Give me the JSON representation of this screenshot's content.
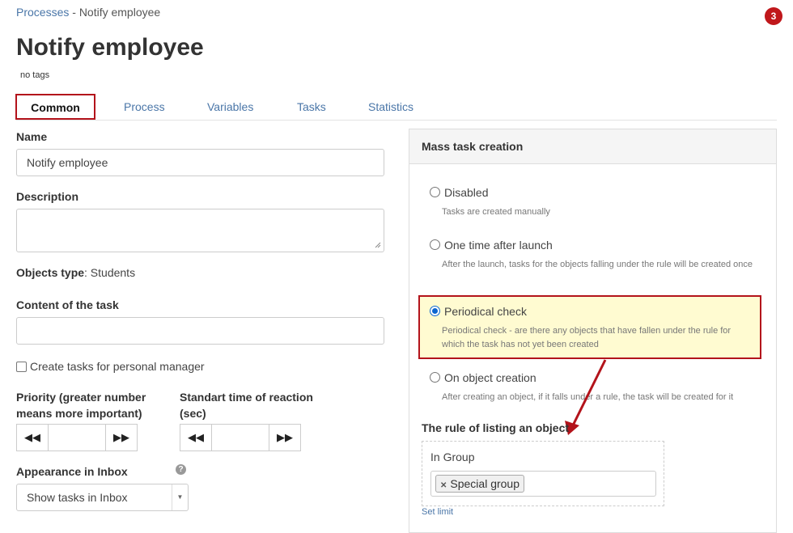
{
  "breadcrumb": {
    "parent": "Processes",
    "separator": "-",
    "current": "Notify employee"
  },
  "notifications_badge": "3",
  "page": {
    "title": "Notify employee",
    "tags": "no tags"
  },
  "tabs": [
    {
      "label": "Common",
      "active": true
    },
    {
      "label": "Process",
      "active": false
    },
    {
      "label": "Variables",
      "active": false
    },
    {
      "label": "Tasks",
      "active": false
    },
    {
      "label": "Statistics",
      "active": false
    }
  ],
  "form": {
    "name_label": "Name",
    "name_value": "Notify employee",
    "description_label": "Description",
    "description_value": "",
    "objects_type_label": "Objects type",
    "objects_type_value": ": Students",
    "content_label": "Content of the task",
    "content_value": "",
    "personal_manager_label": "Create tasks for personal manager",
    "priority_label_1": "Priority (greater number",
    "priority_label_2": "means more important)",
    "priority_value": "",
    "reaction_label_1": "Standart time of reaction",
    "reaction_label_2": "(sec)",
    "reaction_value": "",
    "appearance_label": "Appearance in Inbox",
    "appearance_value": "Show tasks in Inbox"
  },
  "mass_task": {
    "title": "Mass task creation",
    "options": [
      {
        "label": "Disabled",
        "desc": "Tasks are created manually",
        "checked": false
      },
      {
        "label": "One time after launch",
        "desc": "After the launch, tasks for the objects falling under the rule will be created once",
        "checked": false
      },
      {
        "label": "Periodical check",
        "desc": "Periodical check - are there any objects that have fallen under the rule for which the task has not yet been created",
        "checked": true
      },
      {
        "label": "On object creation",
        "desc": "After creating an object, if it falls under a rule, the task will be created for it",
        "checked": false
      }
    ],
    "rule_title": "The rule of listing an object",
    "rule_group_label": "In Group",
    "rule_chip": "Special group",
    "set_limit": "Set limit"
  },
  "colors": {
    "accent_red": "#b3131b",
    "link_blue": "#4a76a8",
    "highlight_bg": "#fffbd1",
    "radio_blue": "#0b66d0"
  },
  "icons": [
    "help-icon",
    "rewind-icon",
    "fast-forward-icon",
    "caret-down-icon",
    "remove-chip-icon",
    "resize-handle-icon"
  ]
}
